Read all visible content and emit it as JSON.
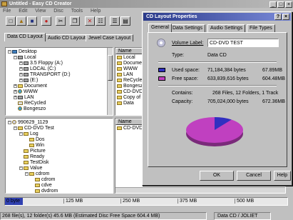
{
  "app": {
    "title": "Untitled - Easy CD Creator"
  },
  "menu": [
    "File",
    "Edit",
    "View",
    "Disc",
    "Tools",
    "Help"
  ],
  "toolbar": {
    "buttons": [
      "new-icon",
      "open-icon",
      "save-icon",
      "record-icon",
      "cut-icon",
      "copy-icon",
      "delete-icon",
      "properties-icon",
      "list-icon",
      "details-icon"
    ]
  },
  "tabs": [
    "Data CD Layout",
    "Audio CD Layout",
    "Jewel Case Layout"
  ],
  "explorer": {
    "tree": [
      {
        "label": "Desktop",
        "indent": 0,
        "icon": "desktop",
        "expander": "-"
      },
      {
        "label": "Local",
        "indent": 1,
        "icon": "computer",
        "expander": "-"
      },
      {
        "label": "3.5 Floppy (A:)",
        "indent": 2,
        "icon": "drive",
        "expander": "+"
      },
      {
        "label": "LOCAL (C:)",
        "indent": 2,
        "icon": "drive",
        "expander": "+"
      },
      {
        "label": "TRANSPORT (D:)",
        "indent": 2,
        "icon": "drive",
        "expander": "+"
      },
      {
        "label": "(E:)",
        "indent": 2,
        "icon": "cdrom",
        "expander": "+"
      },
      {
        "label": "Document",
        "indent": 1,
        "icon": "folder",
        "expander": "+"
      },
      {
        "label": "WWW",
        "indent": 1,
        "icon": "web",
        "expander": "+"
      },
      {
        "label": "LAN",
        "indent": 1,
        "icon": "network",
        "expander": "+"
      },
      {
        "label": "ReCycled",
        "indent": 1,
        "icon": "recycle",
        "expander": ""
      },
      {
        "label": "Bongeszo",
        "indent": 1,
        "icon": "web",
        "expander": ""
      }
    ],
    "list_header": "Name",
    "list": [
      "Local",
      "Document",
      "WWW",
      "LAN",
      "ReCycled",
      "Bongeszo",
      "CD-DVD T",
      "Copy of CD",
      "Data"
    ]
  },
  "layout": {
    "tree": [
      {
        "label": "990629_1129",
        "indent": 0,
        "icon": "cd",
        "expander": "-"
      },
      {
        "label": "CD-DVD Test",
        "indent": 1,
        "icon": "folder",
        "expander": "-"
      },
      {
        "label": "Log",
        "indent": 2,
        "icon": "folder",
        "expander": "-"
      },
      {
        "label": "Dos",
        "indent": 3,
        "icon": "folder",
        "expander": ""
      },
      {
        "label": "Win",
        "indent": 3,
        "icon": "folder",
        "expander": ""
      },
      {
        "label": "Picture",
        "indent": 2,
        "icon": "folder",
        "expander": ""
      },
      {
        "label": "Ready",
        "indent": 2,
        "icon": "folder",
        "expander": ""
      },
      {
        "label": "TestDisk",
        "indent": 2,
        "icon": "folder",
        "expander": ""
      },
      {
        "label": "Value",
        "indent": 2,
        "icon": "folder",
        "expander": "-"
      },
      {
        "label": "cdrom",
        "indent": 3,
        "icon": "folder",
        "expander": "-"
      },
      {
        "label": "cdrom",
        "indent": 4,
        "icon": "folder",
        "expander": ""
      },
      {
        "label": "cdve",
        "indent": 4,
        "icon": "folder",
        "expander": ""
      },
      {
        "label": "dvdrom",
        "indent": 4,
        "icon": "folder",
        "expander": ""
      }
    ],
    "list_header": "Name",
    "list": [
      "CD-DVD"
    ]
  },
  "capacity_bar": {
    "ticks": [
      "0 byte",
      "125 MB",
      "250 MB",
      "375 MB",
      "500 MB"
    ],
    "fill_fraction": 0.062
  },
  "status": {
    "left": "268 file(s), 12 folder(s) 45.6 MB (Estimated Disc Free Space 604.4 MB)",
    "right": "Data CD / JOLIET"
  },
  "dialog": {
    "title": "CD Layout Properties",
    "tabs": [
      "General",
      "Data Settings",
      "Audio Settings",
      "File Types"
    ],
    "volume_label_caption": "Volume Label:",
    "volume_label_value": "CD-DVD TEST",
    "type_caption": "Type:",
    "type_value": "Data CD",
    "used_caption": "Used space:",
    "used_bytes": "71,184,384 bytes",
    "used_mb": "67.89MB",
    "free_caption": "Free space:",
    "free_bytes": "633,839,616 bytes",
    "free_mb": "604.48MB",
    "contains_caption": "Contains:",
    "contains_value": "268 Files, 12 Folders, 1 Track",
    "capacity_caption": "Capacity:",
    "capacity_bytes": "705,024,000 bytes",
    "capacity_mb": "672.36MB",
    "used_fraction": 0.101,
    "used_color": "#3030c0",
    "free_color": "#c040c0",
    "buttons": {
      "ok": "OK",
      "cancel": "Cancel",
      "help": "Help"
    }
  }
}
